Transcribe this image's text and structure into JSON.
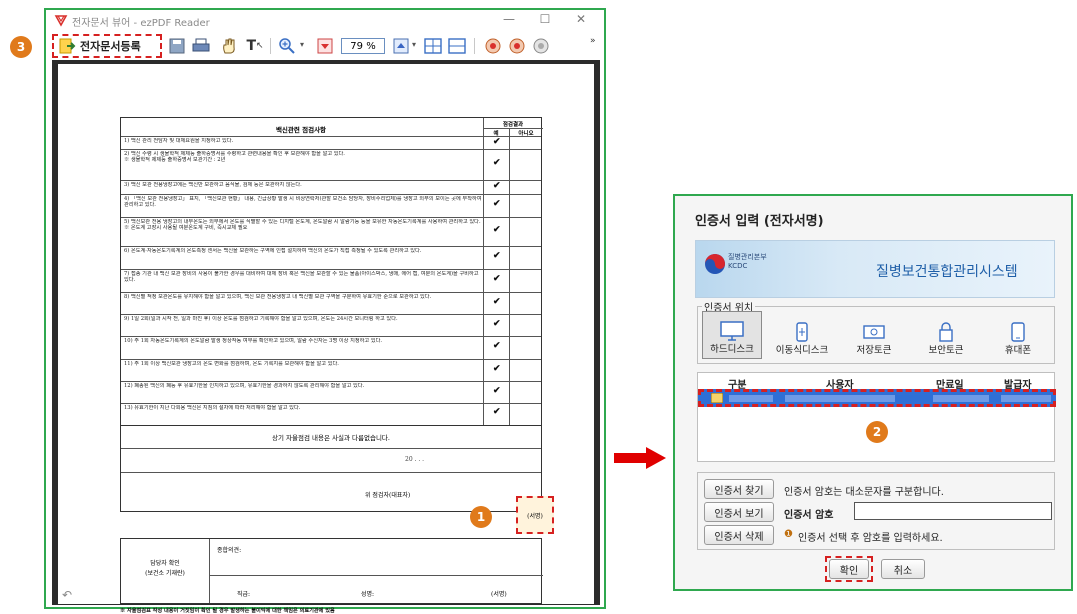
{
  "colors": {
    "frame_green": "#2fa84f",
    "highlight_red": "#d62020",
    "badge_orange": "#e07a1b",
    "cert_select_blue": "#2f6fd6"
  },
  "left_window": {
    "title": "전자문서 뷰어 - ezPDF Reader",
    "step_badge": "3",
    "toolbar": {
      "register_label": "전자문서등록",
      "zoom_value": "79 %",
      "icons": [
        "save-icon",
        "print-icon",
        "hand-icon",
        "text-select-icon",
        "zoom-in-icon",
        "down-arrow-icon",
        "up-arrow-icon",
        "single-page-icon",
        "two-page-icon",
        "rotate-left-icon",
        "rotate-right-icon",
        "fit-icon"
      ]
    },
    "document": {
      "table_title": "백신관련 점검사항",
      "result_header": "점검결과",
      "yes_header": "예",
      "no_header": "아니오",
      "rows": [
        {
          "text": "1) 백신 관리 전담자 및 대체요원을 지정하고 있다.",
          "mark": "✔"
        },
        {
          "text": "2) 백신 수령 시 생물학적 제제등 출하증명서를 수령하고 관련내용을 확인 후 보관해야 함을 알고 있다.\n※ 생물학적 제제등 출하증명서 보관기간 : 2년",
          "mark": "✔"
        },
        {
          "text": "3) 백신 보관 전용냉장고에는 백신만 보관하고 음식물, 검체 등은 보관하지 않는다.",
          "mark": "✔"
        },
        {
          "text": "4) 「백신 보관 전용냉장고」 표지, 「백신보관 현황」 내용, 긴급상황 발생 시 비상연락처(관할 보건소 담당자, 장비수리업체)를 냉장고 외부의 보이는 곳에 부착하여 관리하고 있다.",
          "mark": "✔"
        },
        {
          "text": "5) 백신보관 전용 냉장고의 내부온도는 외부에서 온도를 식별할 수 있는 디지털 온도계, 온도알람 시 알람기능 등을 보유한 자동온도기록계를 사용하여 관리하고 있다.\n※ 온도계 고장시 사용될 여분온도계 구비, 즉시교체 필요",
          "mark": "✔"
        },
        {
          "text": "6) 온도계·자동온도기록계의 온도측정 센서는 백신을 보관하는 구역에 인접 설치하여 백신의 온도가 직접 측정될 수 있도록 관리하고 있다.",
          "mark": "✔"
        },
        {
          "text": "7) 접종 기관 내 백신 보관 장비의 사용이 불가한 경우를 대비하여 대체 장비 혹은 백신을 보관할 수 있는 물품(아이스박스, 냉매, 에어 캡, 여분의 온도계)을 구비하고 있다.",
          "mark": "✔"
        },
        {
          "text": "8) 백신별 적정 보관온도를 유지해야 함을 알고 있으며, 백신 보관 전용냉장고 내 백신별 보관 구역을 구분하여 유효기한 순으로 보관하고 있다.",
          "mark": "✔"
        },
        {
          "text": "9) 1일 2회(일과 시작 전, 일과 마친 후) 이상 온도를 점검하고 기록해야 함을 알고 있으며, 온도는 24시간 모니터링 하고 있다.",
          "mark": "✔"
        },
        {
          "text": "10) 주 1회 자동온도기록계의 온도알람 발생 정상작동 여부를 확인하고 있으며, 알람 수신자는 3명 이상 지정하고 있다.",
          "mark": "✔"
        },
        {
          "text": "11) 주 1회 이상 백신보관 냉장고의 온도 변화를 점검하며, 온도 기록지를 보관해야 함을 알고 있다.",
          "mark": "✔"
        },
        {
          "text": "12) 폐송된 백신의 폐등 후 유효기한을 인지하고 있으며, 유효기한을 경과하지 않도록 관리해야 함을 알고 있다.",
          "mark": "✔"
        },
        {
          "text": "13) 유효기한이 지난 다회용 백신은 지침의 절차에 따라 처리해야 함을 알고 있다.",
          "mark": "✔"
        }
      ],
      "confirm_statement": "상기 자율점검 내용은 사실과 다름없습니다.",
      "date_text": "20 .   .   .",
      "inspector_label": "위 점검자(대표자)",
      "sign_label": "(서명)",
      "sign_badge": "1",
      "manager_label_1": "담당자 확인",
      "manager_label_2": "(보건소 기재란)",
      "overall_label": "종합의견:",
      "position_label": "직급:",
      "name_label": "성명:",
      "manager_sign_label": "(서명)",
      "footnote": "※ 자율점검표 작성 내용이 거짓임이 확인 될 경우 발생하는 불이익에 대한 책임은 의료기관에 있음"
    }
  },
  "dialog": {
    "title": "인증서 입력 (전자서명)",
    "banner": {
      "org_line1": "질병관리본부",
      "org_line2": "KCDC",
      "system_name": "질병보건통합관리시스템"
    },
    "location_legend": "인증서 위치",
    "locations": [
      {
        "label": "하드디스크",
        "icon": "hard-disk-icon"
      },
      {
        "label": "이동식디스크",
        "icon": "removable-disk-icon"
      },
      {
        "label": "저장토큰",
        "icon": "storage-token-icon"
      },
      {
        "label": "보안토큰",
        "icon": "security-token-icon"
      },
      {
        "label": "휴대폰",
        "icon": "phone-icon"
      }
    ],
    "columns": [
      "구분",
      "사용자",
      "만료일",
      "발급자"
    ],
    "step_badge": "2",
    "find_button": "인증서 찾기",
    "view_button": "인증서 보기",
    "delete_button": "인증서 삭제",
    "case_hint": "인증서 암호는 대소문자를 구분합니다.",
    "password_label": "인증서 암호",
    "select_hint": "인증서 선택 후 암호를 입력하세요.",
    "ok_button": "확인",
    "cancel_button": "취소"
  }
}
